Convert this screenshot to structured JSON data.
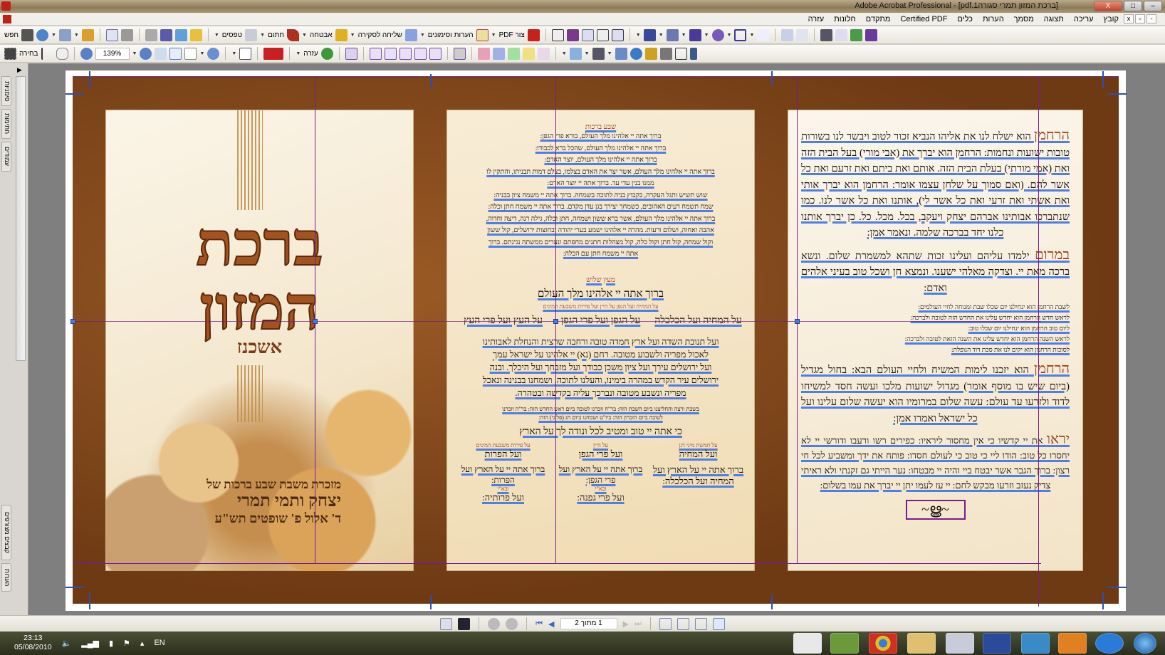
{
  "window": {
    "title": "[ברכת המזון תמרי סגורה1.pdf] - Adobe Acrobat Professional",
    "min": "–",
    "max": "□",
    "close": "X"
  },
  "menu": {
    "items": [
      "קובץ",
      "עריכה",
      "תצוגה",
      "מסמך",
      "הערות",
      "כלים",
      "Certified PDF",
      "מתקדם",
      "חלונות",
      "עזרה"
    ],
    "mdi": [
      "x",
      "▫",
      "-"
    ]
  },
  "toolbar1": {
    "search": "חפש",
    "forms": "טפסים",
    "sign": "חתום",
    "secure": "אבטחה",
    "review": "שליחה לסקירה",
    "comments": "הערות וסימונים",
    "create_pdf": "צור PDF"
  },
  "toolbar2": {
    "select": "בחירה",
    "zoom": "139%",
    "help": "עזרה"
  },
  "side_tabs": [
    "סימניות",
    "חתימות",
    "עמודים",
    "קבצים מצורפים",
    "הערות"
  ],
  "cover": {
    "title1": "ברכת",
    "title2": "המזון",
    "rite": "אשכנז",
    "line1": "מזכרת משבת שבע ברכות של",
    "line2": "יצחק ותמי תמרי",
    "line3": "ד' אלול פ' שופטים תש\"ע"
  },
  "middle": {
    "heading1": "שבע ברכות",
    "sheva": [
      "ברוך אתה יי אלהינו מלך העולם, בורא פרי הגפן:",
      "ברוך אתה יי אלהינו מלך העולם, שהכל ברא לכבודו:",
      "ברוך אתה יי אלהינו מלך העולם, יוצר האדם:",
      "ברוך אתה יי אלהינו מלך העולם, אשר יצר את האדם בצלמו, בצלם דמות תבניתו, והתקין לו",
      "ממנו בנין עדי עד. ברוך אתה יי יוצר האדם:",
      "שוש תשיש ותגל העקרה, בקבוץ בניה לתוכה בשמחה. ברוך אתה יי משמח ציון בבניה:",
      "שמח תשמח רעים האהובים, כשמחך יצירך בגן עדן מקדם. ברוך אתה יי משמח חתן וכלה:",
      "ברוך אתה יי אלהינו מלך העולם, אשר ברא ששון ושמחה, חתן וכלה, גילה רנה, דיצה וחדוה,",
      "אהבה ואחוה, ושלום ורעות. מהרה יי אלהינו ישמע בערי יהודה ובחוצות ירושלים, קול ששון",
      "וקול שמחה, קול חתן וקול כלה, קול מצהלות חתנים מחפתם ונערים ממשתה נגינתם. ברוך",
      "אתה יי משמח חתן עם הכלה:"
    ],
    "heading2": "מעין שלוש",
    "blessing": "ברוך אתה יי אלהינו מלך העולם",
    "note": "על המחיה ועל הגפן על היין ועל פירות משבעת המינים",
    "cols1": [
      "על המחיה ועל הכלכלה",
      "על הגפן ועל פרי הגפן",
      "על העץ ועל פרי העץ"
    ],
    "para": [
      "ועל תנובת השדה ועל ארץ חמדה טובה ורחבה שרצית והנחלת לאבותינו",
      "לאכול מפריה ולשבוע מטובה. רחם (נא) יי אלהינו על ישראל עמך",
      "ועל ירושלים עירך ועל ציון משכן כבודך ועל מזבחך ועל היכלך. ובנה",
      "ירושלים עיר הקדש במהרה בימינו, והעלנו לתוכה, ושמחנו בבנינה ונאכל",
      "מפריה ונשבע מטובה ונברכך עליה בקדשה ובטהרה."
    ],
    "small": [
      "בשבת ורצה והחליצנו ביום השבת הזה: בר\"ח וזכרנו לטובה ביום ראש החדש הזה: בר\"ה וזכרנו",
      "לטובה ביום הזכרון הזה: ביו\"ט ושמחנו ביום חג (פלוני) הזה:"
    ],
    "ki_ata": "כי אתה יי טוב ומטיב לכל ונודה לך על הארץ",
    "cols2": [
      {
        "label": "על חמשת מיני דגן",
        "a": "ועל המחיה",
        "b": "ברוך אתה יי על הארץ ועל המחיה ועל הכלכלה:",
        "c": "",
        "d": ""
      },
      {
        "label": "על היין",
        "a": "ועל פרי הגפן",
        "b": "ברוך אתה יי על הארץ ועל פרי הגפן:",
        "c": "ובא\"י",
        "d": "ועל פרי גפנה:"
      },
      {
        "label": "על פירות משבעת המינים",
        "a": "ועל הפרות",
        "b": "ברוך אתה יי על הארץ ועל הפרות:",
        "c": "ובא\"י",
        "d": "ועל פרותיה:"
      }
    ]
  },
  "right": {
    "p1_word": "הרחמן",
    "p1": [
      "הוא ישלח לנו את אליהו הנביא זכור לטוב ויבשר",
      "לנו בשורות טובות ישועות ונחמות: הרחמן הוא יברך את",
      "(אבי מורי) בעל הבית הזה ואת (אמי מורתי) בעלת הבית",
      "הזה. אותם ואת ביתם ואת זרעם ואת כל אשר להם. (ואם סמוך",
      "על שלחן עצמו אומר: הרחמן הוא יברך אותי ואת אשתי ואת זרעי",
      "ואת כל אשר לי), אותנו ואת כל אשר לנו. כמו שנתברכו",
      "אבותינו אברהם יצחק ויעקב, בכל. מכל. כל. כן יברך אותנו",
      "כלנו יחד בברכה שלמה. ונאמר אמן:"
    ],
    "p2_word": "במרום",
    "p2": [
      "ילמדו עליהם ועלינו זכות שתהא למשמרת שלום.",
      "ונשא ברכה מאת יי. וצדקה מאלהי ישענו. ונמצא חן ושכל",
      "טוב בעיני אלהים ואדם:"
    ],
    "small": [
      "לשבת הרחמן הוא ינחילנו יום שכלו שבת ומנוחה לחיי העולמים:",
      "לראש חדש הרחמן הוא יחדש עלינו את החדש הזה לטובה ולברכה:",
      "ליום טוב הרחמן הוא ינחילנו יום שכלו טוב:",
      "לראש השנה הרחמן הוא יחדש עלינו את השנה הזאת לטובה ולברכה:",
      "לסוכות הרחמן הוא יקים לנו את סכת דוד הנופלת:"
    ],
    "p3_word": "הרחמן",
    "p3": [
      "הוא יזכנו לימות המשיח ולחיי העולם הבא: בחול",
      "מגדיל (ביום שיש בו מוסף אומר) מגדול ישועות מלכו ועשה חסד",
      "למשיחו לדוד ולזרעו עד עולם: עשה שלום במרומיו הוא",
      "יעשה שלום עלינו ועל כל ישראל ואמרו אמן:"
    ],
    "p4_word": "יראו",
    "p4": [
      "את יי קדשיו כי אין מחסור ליראיו: כפירים רשו ורעבו",
      "ודורשי יי לא יחסרו כל טוב: הודו ליי כי טוב כי לעולם חסדו:",
      "פותח את ידך ומשביע לכל חי רצון: ברוך הגבר אשר יבטח ביי",
      "והיה יי מבטחו: נער הייתי גם זקנתי ולא ראיתי צדיק נעזב וזרעו",
      "מבקש לחם: יי עז לעמו יתן יי יברך את עמו בשלום:"
    ]
  },
  "status": {
    "page": "1 מתוך 2"
  },
  "taskbar": {
    "time": "23:13",
    "date": "05/08/2010",
    "lang": "EN"
  },
  "colors": {
    "guide": "#7a1c8c",
    "handle": "#4a7ae0",
    "brown": "#6e3a14",
    "title_red": "#a2531f"
  }
}
